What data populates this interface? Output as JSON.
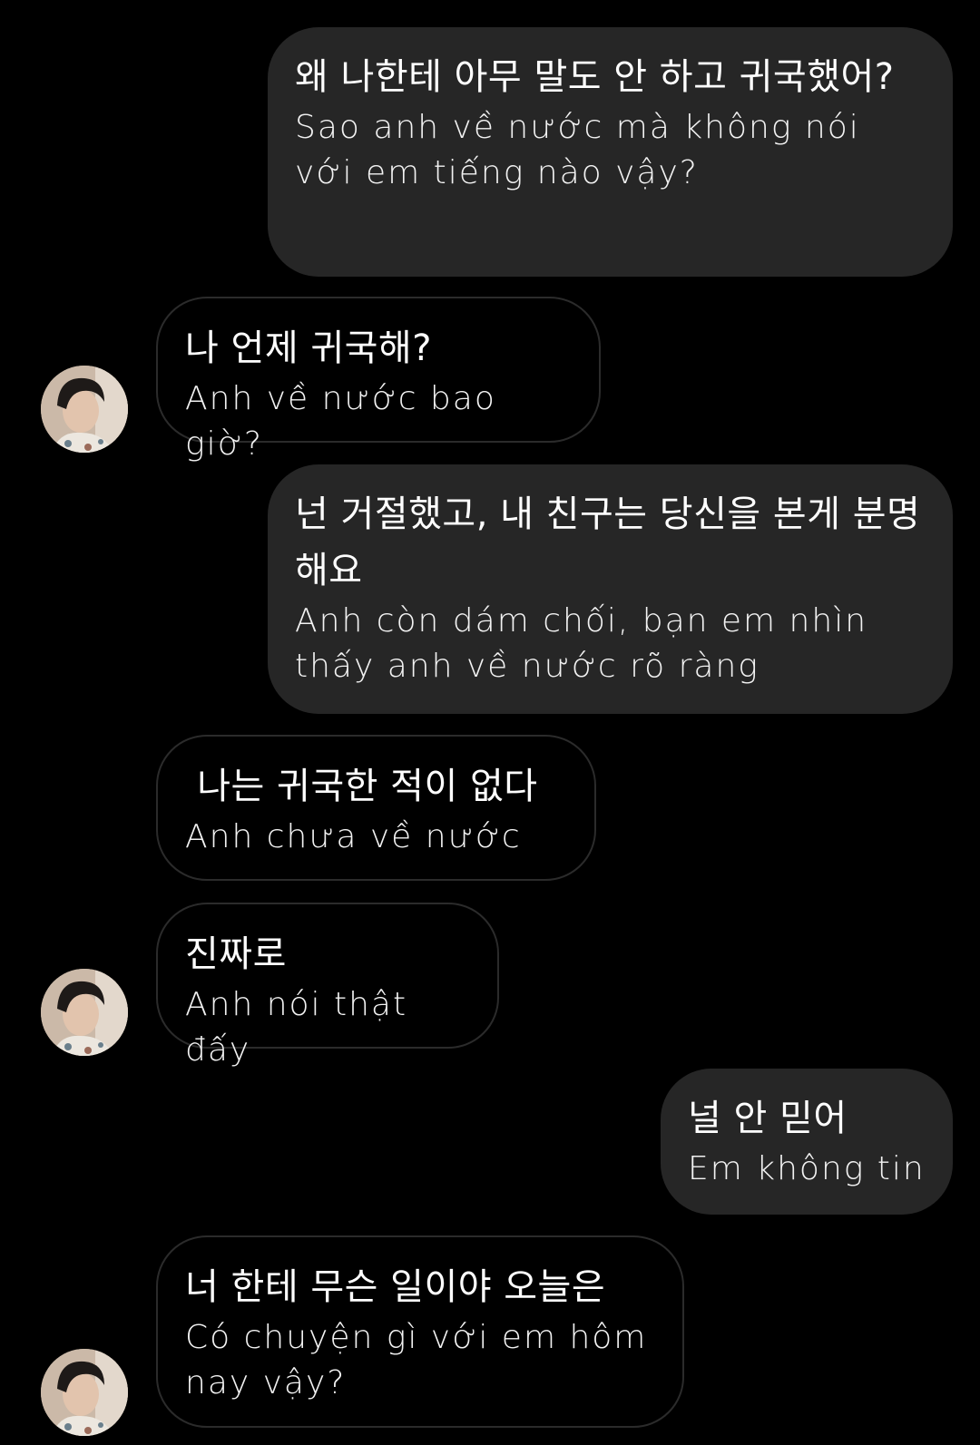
{
  "messages": [
    {
      "side": "sent",
      "ko": "왜 나한테 아무 말도 안 하고 귀국했어?",
      "vi": "Sao anh về nước mà không nói với em tiếng nào vậy?"
    },
    {
      "side": "received",
      "ko": "나 언제 귀국해?",
      "vi": "Anh về nước bao giờ?"
    },
    {
      "side": "sent",
      "ko": "넌 거절했고, 내 친구는 당신을 본게 분명해요",
      "vi": "Anh còn dám chối, bạn em nhìn thấy anh về nước rõ ràng"
    },
    {
      "side": "received",
      "ko": " 나는 귀국한 적이 없다",
      "vi": "Anh chưa về nước"
    },
    {
      "side": "received",
      "ko": "진짜로",
      "vi": "Anh nói thật đấy"
    },
    {
      "side": "sent",
      "ko": "널 안 믿어",
      "vi": "Em không tin"
    },
    {
      "side": "received",
      "ko": "너 한테 무슨 일이야 오늘은",
      "vi": "Có chuyện gì với em hôm nay vậy?"
    }
  ]
}
